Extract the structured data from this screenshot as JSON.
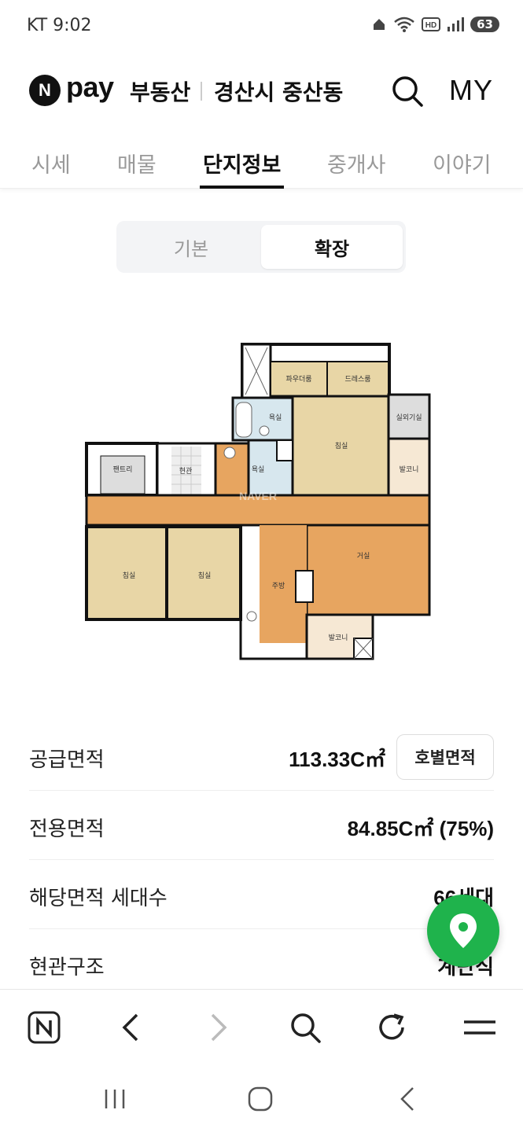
{
  "status_bar": {
    "carrier_time": "KT 9:02",
    "battery": "63"
  },
  "header": {
    "logo_n": "N",
    "logo_pay": "pay",
    "service": "부동산",
    "region": "경산시 중산동",
    "my_label": "MY"
  },
  "tabs": [
    {
      "label": "시세"
    },
    {
      "label": "매물"
    },
    {
      "label": "단지정보",
      "active": true
    },
    {
      "label": "중개사"
    },
    {
      "label": "이야기"
    }
  ],
  "segment": {
    "basic": "기본",
    "extended": "확장",
    "selected": "확장"
  },
  "floorplan": {
    "watermark": "NAVER",
    "rooms": {
      "powder_room": "파우더룸",
      "dress_room": "드레스룸",
      "bath1": "욕실",
      "bath2": "욕실",
      "master_bedroom": "침실",
      "outdoor_unit": "실외기실",
      "balcony1": "발코니",
      "pantry": "팬트리",
      "entrance": "현관",
      "living_room": "거실",
      "bedroom2": "침실",
      "bedroom3": "침실",
      "kitchen": "주방",
      "balcony2": "발코니"
    }
  },
  "info": {
    "supply_area_label": "공급면적",
    "supply_area_value": "113.33C㎡",
    "ho_area_button": "호별면적",
    "exclusive_area_label": "전용면적",
    "exclusive_area_value": "84.85C㎡ (75%)",
    "households_label": "해당면적 세대수",
    "households_value": "66세대",
    "entrance_label": "현관구조",
    "entrance_value": "계단식"
  },
  "colors": {
    "fab": "#1fb34c",
    "floor_wood": "#e7a560",
    "room_beige": "#e8d6a6"
  }
}
